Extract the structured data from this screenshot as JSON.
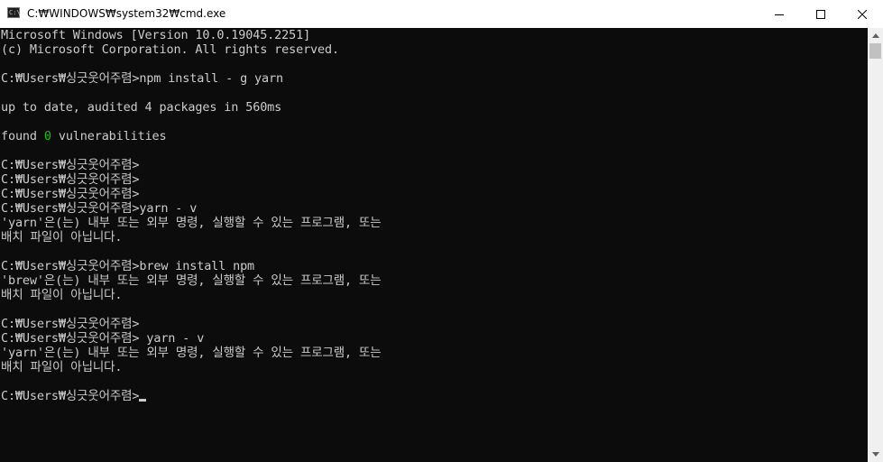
{
  "window": {
    "title": "C:₩WINDOWS₩system32₩cmd.exe",
    "icon_text": "C:\\"
  },
  "console": {
    "lines": [
      {
        "text": "Microsoft Windows [Version 10.0.19045.2251]"
      },
      {
        "text": "(c) Microsoft Corporation. All rights reserved."
      },
      {
        "text": ""
      },
      {
        "text": "C:₩Users₩싱긋웃어주렴>npm install - g yarn"
      },
      {
        "text": ""
      },
      {
        "text": "up to date, audited 4 packages in 560ms"
      },
      {
        "text": ""
      },
      {
        "text": "found ",
        "highlight": "0",
        "after": " vulnerabilities"
      },
      {
        "text": ""
      },
      {
        "text": "C:₩Users₩싱긋웃어주렴>"
      },
      {
        "text": "C:₩Users₩싱긋웃어주렴>"
      },
      {
        "text": "C:₩Users₩싱긋웃어주렴>"
      },
      {
        "text": "C:₩Users₩싱긋웃어주렴>yarn - v"
      },
      {
        "text": "'yarn'은(는) 내부 또는 외부 명령, 실행할 수 있는 프로그램, 또는"
      },
      {
        "text": "배치 파일이 아닙니다."
      },
      {
        "text": ""
      },
      {
        "text": "C:₩Users₩싱긋웃어주렴>brew install npm"
      },
      {
        "text": "'brew'은(는) 내부 또는 외부 명령, 실행할 수 있는 프로그램, 또는"
      },
      {
        "text": "배치 파일이 아닙니다."
      },
      {
        "text": ""
      },
      {
        "text": "C:₩Users₩싱긋웃어주렴>"
      },
      {
        "text": "C:₩Users₩싱긋웃어주렴> yarn - v"
      },
      {
        "text": "'yarn'은(는) 내부 또는 외부 명령, 실행할 수 있는 프로그램, 또는"
      },
      {
        "text": "배치 파일이 아닙니다."
      },
      {
        "text": ""
      },
      {
        "text": "C:₩Users₩싱긋웃어주렴>",
        "cursor": true
      }
    ]
  },
  "colors": {
    "console_bg": "#0c0c0c",
    "console_fg": "#cccccc",
    "highlight": "#16c60c",
    "titlebar_bg": "#ffffff"
  }
}
